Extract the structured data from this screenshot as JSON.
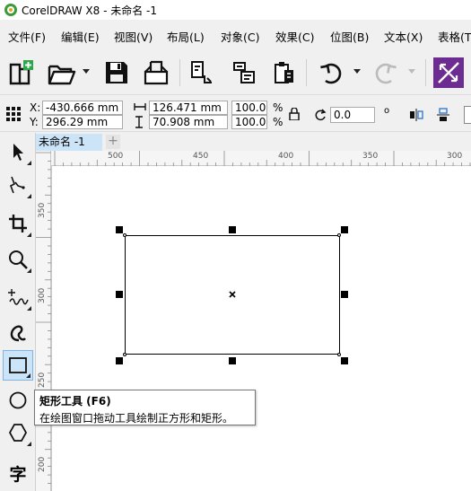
{
  "window": {
    "title": "CorelDRAW X8 - 未命名 -1"
  },
  "menu": [
    {
      "label": "文件(F)"
    },
    {
      "label": "编辑(E)"
    },
    {
      "label": "视图(V)"
    },
    {
      "label": "布局(L)"
    },
    {
      "label": "对象(C)"
    },
    {
      "label": "效果(C)"
    },
    {
      "label": "位图(B)"
    },
    {
      "label": "文本(X)"
    },
    {
      "label": "表格(T)"
    }
  ],
  "toolbar": {
    "icons": [
      "new-document-icon",
      "open-folder-icon",
      "save-icon",
      "print-icon",
      "import-icon",
      "export-icon",
      "publish-pdf-icon",
      "undo-icon",
      "redo-icon",
      "launch-icon"
    ]
  },
  "properties": {
    "x_label": "X:",
    "x_value": "-430.666 mm",
    "y_label": "Y:",
    "y_value": "296.29 mm",
    "width_value": "126.471 mm",
    "height_value": "70.908 mm",
    "scale_x": "100.0",
    "scale_y": "100.0",
    "percent_x": "%",
    "percent_y": "%",
    "rotation_value": "0.0",
    "degree_symbol": "o"
  },
  "document": {
    "tab_label": "未命名 -1",
    "add_tab_label": "+"
  },
  "rulers": {
    "horizontal": [
      "500",
      "450",
      "400",
      "350",
      "300"
    ],
    "vertical": [
      "350",
      "300",
      "250",
      "200"
    ]
  },
  "tools": {
    "active": "rectangle-tool",
    "text_tool_char": "字"
  },
  "tooltip": {
    "title": "矩形工具 (F6)",
    "description": "在绘图窗口拖动工具绘制正方形和矩形。"
  },
  "colors": {
    "accent": "#cce4f7",
    "accent_border": "#7eb4ea",
    "launch_purple": "#6d2c91",
    "new_doc_green": "#2aa84a"
  }
}
